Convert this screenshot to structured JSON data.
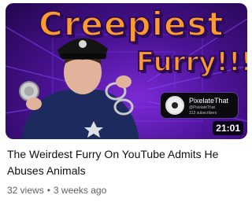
{
  "thumbnail": {
    "overlay_line1": "Creepiest",
    "overlay_line2": "Furry!!!",
    "channel_name": "PixelateThat",
    "channel_handle": "@PixelateThat",
    "channel_subscribers": "313 subscribers",
    "duration": "21:01"
  },
  "video": {
    "title": "The Weirdest Furry On YouTube Admits He Abuses Animals",
    "views": "32 views",
    "separator": "•",
    "age": "3 weeks ago"
  },
  "colors": {
    "overlay_text": "#ff9a2e",
    "background_purple": "#4b1396",
    "title_text": "#0f0f0f",
    "meta_text": "#606060"
  }
}
